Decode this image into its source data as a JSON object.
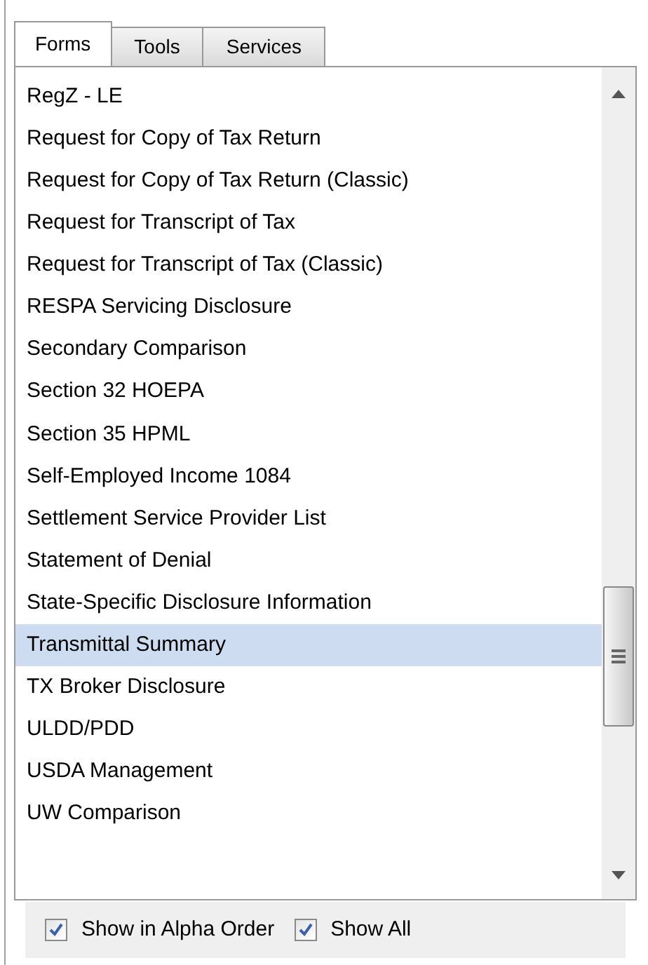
{
  "tabs": [
    {
      "label": "Forms",
      "selected": true
    },
    {
      "label": "Tools",
      "selected": false
    },
    {
      "label": "Services",
      "selected": false
    }
  ],
  "list": {
    "items": [
      {
        "label": "RegZ - LE",
        "selected": false
      },
      {
        "label": "Request for Copy of Tax Return",
        "selected": false
      },
      {
        "label": "Request for Copy of Tax Return (Classic)",
        "selected": false
      },
      {
        "label": "Request for Transcript of Tax",
        "selected": false
      },
      {
        "label": "Request for Transcript of Tax (Classic)",
        "selected": false
      },
      {
        "label": "RESPA Servicing Disclosure",
        "selected": false
      },
      {
        "label": "Secondary Comparison",
        "selected": false
      },
      {
        "label": "Section 32 HOEPA",
        "selected": false
      },
      {
        "label": "Section 35 HPML",
        "selected": false
      },
      {
        "label": "Self-Employed Income 1084",
        "selected": false
      },
      {
        "label": "Settlement Service Provider List",
        "selected": false
      },
      {
        "label": "Statement of Denial",
        "selected": false
      },
      {
        "label": "State-Specific Disclosure Information",
        "selected": false
      },
      {
        "label": "Transmittal Summary",
        "selected": true
      },
      {
        "label": "TX Broker Disclosure",
        "selected": false
      },
      {
        "label": "ULDD/PDD",
        "selected": false
      },
      {
        "label": "USDA Management",
        "selected": false
      },
      {
        "label": "UW Comparison",
        "selected": false
      }
    ]
  },
  "options": [
    {
      "label": "Show in Alpha Order",
      "checked": true
    },
    {
      "label": "Show All",
      "checked": true
    }
  ]
}
